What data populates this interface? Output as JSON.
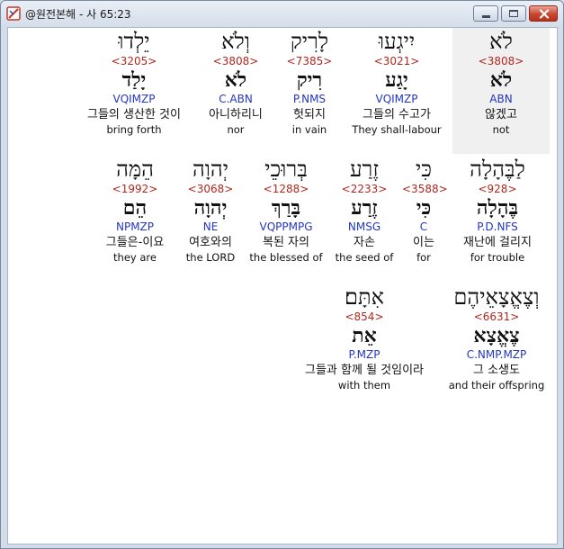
{
  "window": {
    "title": "@원전본해 - 사 65:23"
  },
  "rows": [
    [
      {
        "heb": "לֹא",
        "strong": "<3808>",
        "lemma": "לֹא",
        "morph": "ABN",
        "korean": "않겠고",
        "english": "not",
        "selected": true
      },
      {
        "heb": "יִיגְעוּ",
        "strong": "<3021>",
        "lemma": "יָגַע",
        "morph": "VQIMZP",
        "korean": "그들의 수고가",
        "english": "They shall-labour"
      },
      {
        "heb": "לָרִיק",
        "strong": "<7385>",
        "lemma": "רִיק",
        "morph": "P.NMS",
        "korean": "헛되지",
        "english": "in vain"
      },
      {
        "heb": "וְלֹא",
        "strong": "<3808>",
        "lemma": "לֹא",
        "morph": "C.ABN",
        "korean": "아니하리니",
        "english": "nor"
      },
      {
        "heb": "יֵלְדוּ",
        "strong": "<3205>",
        "lemma": "יָלַד",
        "morph": "VQIMZP",
        "korean": "그들의 생산한 것이",
        "english": "bring forth"
      }
    ],
    [
      {
        "heb": "לַבֶּהָלָה",
        "strong": "<928>",
        "lemma": "בֶּהָלָה",
        "morph": "P.D.NFS",
        "korean": "재난에 걸리지",
        "english": "for trouble"
      },
      {
        "heb": "כִּי",
        "strong": "<3588>",
        "lemma": "כִּי",
        "morph": "C",
        "korean": "이는",
        "english": "for"
      },
      {
        "heb": "זֶרַע",
        "strong": "<2233>",
        "lemma": "זֶרַע",
        "morph": "NMSG",
        "korean": "자손",
        "english": "the seed of"
      },
      {
        "heb": "בְּרוּכֵי",
        "strong": "<1288>",
        "lemma": "בָּרַךְ",
        "morph": "VQPPMPG",
        "korean": "복된 자의",
        "english": "the blessed of"
      },
      {
        "heb": "יְהוָה",
        "strong": "<3068>",
        "lemma": "יְהוָה",
        "morph": "NE",
        "korean": "여호와의",
        "english": "the LORD"
      },
      {
        "heb": "הֵמָּה",
        "strong": "<1992>",
        "lemma": "הֵם",
        "morph": "NPMZP",
        "korean": "그들은-이요",
        "english": "they are"
      }
    ],
    [
      {
        "heb": "וְצֶאֱצָאֵיהֶם",
        "strong": "<6631>",
        "lemma": "צֶאֱצָא",
        "morph": "C.NMP.MZP",
        "korean": "그 소생도",
        "english": "and their offspring"
      },
      {
        "heb": "אִתָּם׃",
        "strong": "<854>",
        "lemma": "אֵת",
        "morph": "P.MZP",
        "korean": "그들과 함께 될 것임이라",
        "english": "with them"
      }
    ]
  ]
}
